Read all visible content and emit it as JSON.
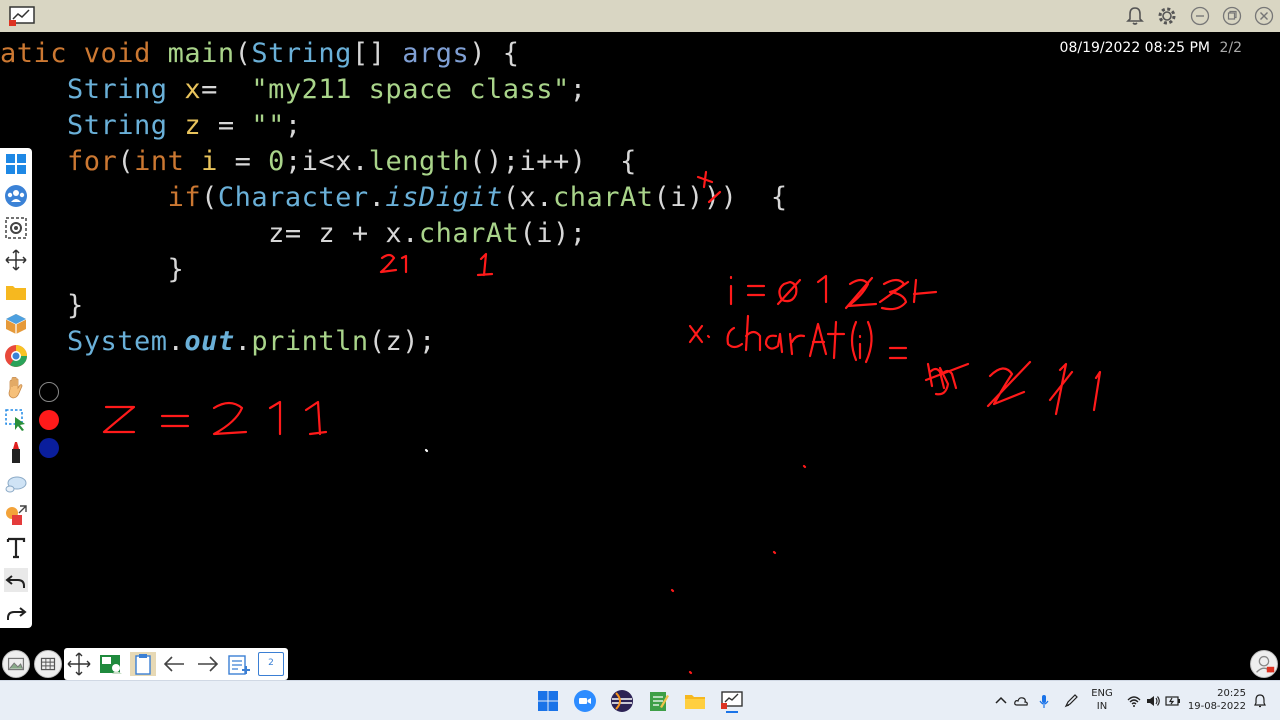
{
  "title_bar": {
    "icons": [
      "whiteboard-app-icon",
      "notification-bell-icon",
      "settings-gear-icon",
      "minimize-icon",
      "restore-icon",
      "close-icon"
    ]
  },
  "board": {
    "code_lines": [
      [
        [
          "kw",
          "atic"
        ],
        [
          "id",
          " "
        ],
        [
          "kw",
          "void"
        ],
        [
          "id",
          " "
        ],
        [
          "fn",
          "main"
        ],
        [
          "id",
          "("
        ],
        [
          "ty",
          "String"
        ],
        [
          "id",
          "[] "
        ],
        [
          "nm",
          "args"
        ],
        [
          "id",
          ") {"
        ]
      ],
      [
        [
          "id",
          "    "
        ],
        [
          "ty",
          "String"
        ],
        [
          "id",
          " "
        ],
        [
          "va",
          "x"
        ],
        [
          "id",
          "=  "
        ],
        [
          "st",
          "\"my211 space class\""
        ],
        [
          "id",
          ";"
        ]
      ],
      [
        [
          "id",
          "    "
        ],
        [
          "ty",
          "String"
        ],
        [
          "id",
          " "
        ],
        [
          "va",
          "z"
        ],
        [
          "id",
          " = "
        ],
        [
          "st",
          "\"\""
        ],
        [
          "id",
          ";"
        ]
      ],
      [
        [
          "id",
          "    "
        ],
        [
          "kw",
          "for"
        ],
        [
          "id",
          "("
        ],
        [
          "kw",
          "int"
        ],
        [
          "id",
          " "
        ],
        [
          "va",
          "i"
        ],
        [
          "id",
          " = "
        ],
        [
          "st",
          "0"
        ],
        [
          "id",
          ";i<x."
        ],
        [
          "fn",
          "length"
        ],
        [
          "id",
          "();i++)  {"
        ]
      ],
      [
        [
          "id",
          "          "
        ],
        [
          "kw",
          "if"
        ],
        [
          "id",
          "("
        ],
        [
          "ty",
          "Character"
        ],
        [
          "id",
          "."
        ],
        [
          "it",
          "isDigit"
        ],
        [
          "id",
          "(x."
        ],
        [
          "fn",
          "charAt"
        ],
        [
          "id",
          "(i)))  {"
        ]
      ],
      [
        [
          "id",
          "                z= z + x."
        ],
        [
          "fn",
          "charAt"
        ],
        [
          "id",
          "(i);"
        ]
      ],
      [
        [
          "id",
          "          }"
        ]
      ],
      [
        [
          "id",
          "    }"
        ]
      ],
      [
        [
          "id",
          "    "
        ],
        [
          "ty",
          "System"
        ],
        [
          "id",
          "."
        ],
        [
          "bi",
          "out"
        ],
        [
          "id",
          "."
        ],
        [
          "fn",
          "println"
        ],
        [
          "id",
          "(z);"
        ]
      ]
    ],
    "timestamp": "08/19/2022 08:25 PM",
    "page_indicator": "2/2",
    "ink_colors": {
      "red": "#ff1a1a",
      "black": "#000000",
      "blue": "#0a1e9c"
    }
  },
  "left_toolbar": {
    "tools": [
      "windows-icon",
      "meeting-icon",
      "screenshot-icon",
      "move-icon",
      "folder-icon",
      "3d-box-icon",
      "browser-icon",
      "hand-icon",
      "select-icon",
      "marker-icon",
      "eraser-icon",
      "shapes-icon",
      "text-icon",
      "undo-icon",
      "redo-icon"
    ]
  },
  "bottom_palette": {
    "page_count": "2"
  },
  "taskbar": {
    "language": "ENG",
    "region": "IN",
    "time": "20:25",
    "date": "19-08-2022"
  }
}
